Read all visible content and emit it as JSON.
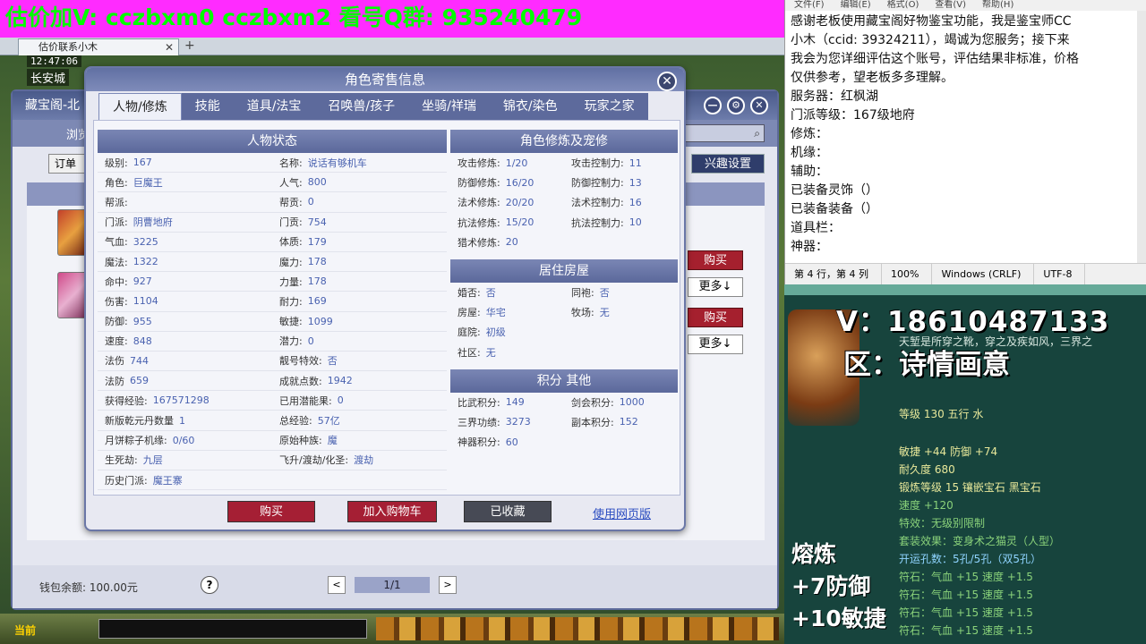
{
  "banner": "估价加V:  cczbxm0  cczbxm2  看号Q群: 935240479",
  "browser": {
    "tab_title": "估价联系小木",
    "tab_close": "✕",
    "tab_add": "+"
  },
  "hud": {
    "time": "12:47:06",
    "place": "长安城"
  },
  "bg_window": {
    "title": "藏宝阁-北",
    "sub_label": "浏览",
    "order_label": "订单",
    "interest_label": "兴趣设置",
    "buy_label": "购买",
    "more_label": "更多↓",
    "wallet": "钱包余额: 100.00元",
    "help": "?",
    "page": "1/1",
    "prev": "<",
    "next": ">",
    "min_icon": "—",
    "settings_icon": "⚙",
    "close_icon": "✕"
  },
  "taskbar": {
    "current": "当前"
  },
  "modal": {
    "title": "角色寄售信息",
    "close": "✕",
    "tabs": [
      "人物/修炼",
      "技能",
      "道具/法宝",
      "召唤兽/孩子",
      "坐骑/祥瑞",
      "锦衣/染色",
      "玩家之家"
    ],
    "left_header": "人物状态",
    "left_rows": [
      [
        {
          "k": "级别:",
          "v": "167"
        },
        {
          "k": "名称:",
          "v": "说话有够机车"
        }
      ],
      [
        {
          "k": "角色:",
          "v": "巨魔王"
        },
        {
          "k": "人气:",
          "v": "800"
        }
      ],
      [
        {
          "k": "帮派:",
          "v": ""
        },
        {
          "k": "帮贡:",
          "v": "0"
        }
      ],
      [
        {
          "k": "门派:",
          "v": "阴曹地府"
        },
        {
          "k": "门贡:",
          "v": "754"
        }
      ],
      [
        {
          "k": "气血:",
          "v": "3225"
        },
        {
          "k": "体质:",
          "v": "179"
        }
      ],
      [
        {
          "k": "魔法:",
          "v": "1322"
        },
        {
          "k": "魔力:",
          "v": "178"
        }
      ],
      [
        {
          "k": "命中:",
          "v": "927"
        },
        {
          "k": "力量:",
          "v": "178"
        }
      ],
      [
        {
          "k": "伤害:",
          "v": "1104"
        },
        {
          "k": "耐力:",
          "v": "169"
        }
      ],
      [
        {
          "k": "防御:",
          "v": "955"
        },
        {
          "k": "敏捷:",
          "v": "1099"
        }
      ],
      [
        {
          "k": "速度:",
          "v": "848"
        },
        {
          "k": "潜力:",
          "v": "0"
        }
      ],
      [
        {
          "k": "法伤",
          "v": "744"
        },
        {
          "k": "靓号特效:",
          "v": "否"
        }
      ],
      [
        {
          "k": "法防",
          "v": "659"
        },
        {
          "k": "成就点数:",
          "v": "1942"
        }
      ],
      [
        {
          "k": "获得经验:",
          "v": "167571298"
        },
        {
          "k": "已用潜能果:",
          "v": "0"
        }
      ],
      [
        {
          "k": "新版乾元丹数量",
          "v": "1"
        },
        {
          "k": "总经验:",
          "v": "57亿"
        }
      ],
      [
        {
          "k": "月饼粽子机缘:",
          "v": "0/60"
        },
        {
          "k": "原始种族:",
          "v": "魔"
        }
      ],
      [
        {
          "k": "生死劫:",
          "v": "九层"
        },
        {
          "k": "飞升/渡劫/化圣:",
          "v": "渡劫"
        }
      ],
      [
        {
          "k": "历史门派:",
          "v": "魔王寨"
        },
        {
          "k": "",
          "v": ""
        }
      ]
    ],
    "right_header1": "角色修炼及宠修",
    "cultivation": [
      [
        {
          "k": "攻击修炼:",
          "v": "1/20"
        },
        {
          "k": "攻击控制力:",
          "v": "11"
        }
      ],
      [
        {
          "k": "防御修炼:",
          "v": "16/20"
        },
        {
          "k": "防御控制力:",
          "v": "13"
        }
      ],
      [
        {
          "k": "法术修炼:",
          "v": "20/20"
        },
        {
          "k": "法术控制力:",
          "v": "16"
        }
      ],
      [
        {
          "k": "抗法修炼:",
          "v": "15/20"
        },
        {
          "k": "抗法控制力:",
          "v": "10"
        }
      ],
      [
        {
          "k": "猎术修炼:",
          "v": "20"
        },
        {
          "k": "",
          "v": ""
        }
      ]
    ],
    "right_header2": "居住房屋",
    "housing": [
      [
        {
          "k": "婚否:",
          "v": "否"
        },
        {
          "k": "同袍:",
          "v": "否"
        }
      ],
      [
        {
          "k": "房屋:",
          "v": "华宅"
        },
        {
          "k": "牧场:",
          "v": "无"
        }
      ],
      [
        {
          "k": "庭院:",
          "v": "初级"
        },
        {
          "k": "",
          "v": ""
        }
      ],
      [
        {
          "k": "社区:",
          "v": "无"
        },
        {
          "k": "",
          "v": ""
        }
      ]
    ],
    "right_header3": "积分 其他",
    "scores": [
      [
        {
          "k": "比武积分:",
          "v": "149"
        },
        {
          "k": "剑会积分:",
          "v": "1000"
        }
      ],
      [
        {
          "k": "三界功绩:",
          "v": "3273"
        },
        {
          "k": "副本积分:",
          "v": "152"
        }
      ],
      [
        {
          "k": "神器积分:",
          "v": "60"
        },
        {
          "k": "",
          "v": ""
        }
      ]
    ],
    "btn_buy": "购买",
    "btn_cart": "加入购物车",
    "btn_fav": "已收藏",
    "web_link": "使用网页版"
  },
  "notepad": {
    "menu": [
      "文件(F)",
      "编辑(E)",
      "格式(O)",
      "查看(V)",
      "帮助(H)"
    ],
    "lines": [
      "感谢老板使用藏宝阁好物鉴宝功能，我是鉴宝师CC",
      "小木（ccid: 39324211），竭诚为您服务；接下来",
      "我会为您详细评估这个账号，评估结果非标准，价格",
      "仅供参考，望老板多多理解。",
      "服务器：红枫湖",
      "门派等级：167级地府",
      "修炼：",
      "机缘：",
      "辅助：",
      "已装备灵饰（）",
      "已装备装备（）",
      "道具栏：",
      "神器："
    ],
    "status": [
      "第 4 行，第 4 列",
      "100%",
      "Windows (CRLF)",
      "UTF-8"
    ]
  },
  "overlay": {
    "v_line": "V：18610487133",
    "qu_line": "区：诗情画意",
    "desc": "天堑是所穿之靴，穿之及疾如风，三界之",
    "level": "等级 130  五行 水",
    "agility": "敏捷 +44  防御 +74",
    "durability": "耐久度 680",
    "forge": "锻炼等级 15  镶嵌宝石 黑宝石",
    "speed": "速度 +120",
    "special": "特效：无级别限制",
    "set": "套装效果：变身术之猫灵（人型）",
    "holes": "开运孔数：5孔/5孔（双5孔）",
    "runes": [
      "符石：气血 +15 速度 +1.5",
      "符石：气血 +15 速度 +1.5",
      "符石：气血 +15 速度 +1.5",
      "符石：气血 +15 速度 +1.5"
    ],
    "melt_title": "熔炼",
    "melt1": "+7防御",
    "melt2": "+10敏捷"
  }
}
